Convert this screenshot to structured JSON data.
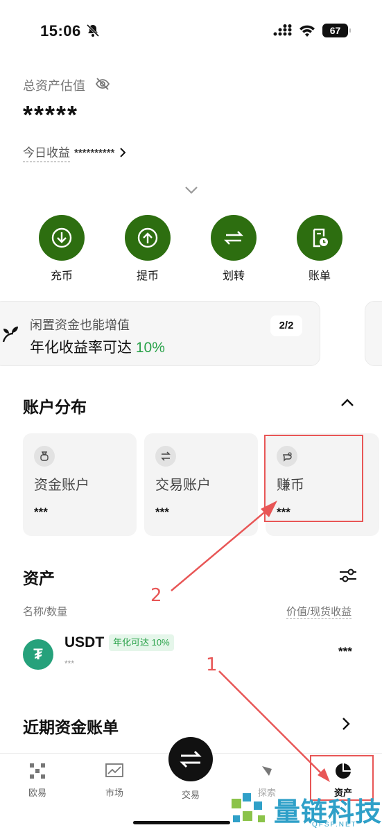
{
  "status_bar": {
    "time": "15:06",
    "battery": "67"
  },
  "header": {
    "asset_label": "总资产估值",
    "asset_value": "*****",
    "today_label": "今日收益",
    "today_value": "**********"
  },
  "actions": [
    {
      "label": "充币",
      "icon": "deposit-icon"
    },
    {
      "label": "提币",
      "icon": "withdraw-icon"
    },
    {
      "label": "划转",
      "icon": "transfer-icon"
    },
    {
      "label": "账单",
      "icon": "bill-icon"
    }
  ],
  "promo": {
    "title": "闲置资金也能增值",
    "subtitle_prefix": "年化收益率可达 ",
    "subtitle_rate": "10%",
    "page": "2/2"
  },
  "accounts": {
    "title": "账户分布",
    "items": [
      {
        "name": "资金账户",
        "value": "***",
        "icon": "bag-icon"
      },
      {
        "name": "交易账户",
        "value": "***",
        "icon": "swap-icon"
      },
      {
        "name": "赚币",
        "value": "***",
        "icon": "piggy-icon"
      }
    ]
  },
  "assets": {
    "title": "资产",
    "col_left": "名称/数量",
    "col_right": "价值/现货收益",
    "rows": [
      {
        "coin": "USDT",
        "badge": "年化可达 10%",
        "sub": "***",
        "value": "***"
      }
    ]
  },
  "recent": {
    "title": "近期资金账单"
  },
  "tabbar": {
    "tabs": [
      {
        "label": "欧易",
        "icon": "okx-logo-icon"
      },
      {
        "label": "市场",
        "icon": "market-chart-icon"
      },
      {
        "label": "交易",
        "icon": "trade-swap-icon"
      },
      {
        "label": "探索",
        "icon": "compass-icon"
      },
      {
        "label": "资产",
        "icon": "pie-chart-icon"
      }
    ]
  },
  "annotations": {
    "one": "1",
    "two": "2"
  },
  "watermark": {
    "text": "量链科技",
    "sub": "QFSP.NET"
  },
  "colors": {
    "accent_green": "#2d6e10",
    "rate_green": "#2aa24a",
    "annotation_red": "#e85656"
  }
}
